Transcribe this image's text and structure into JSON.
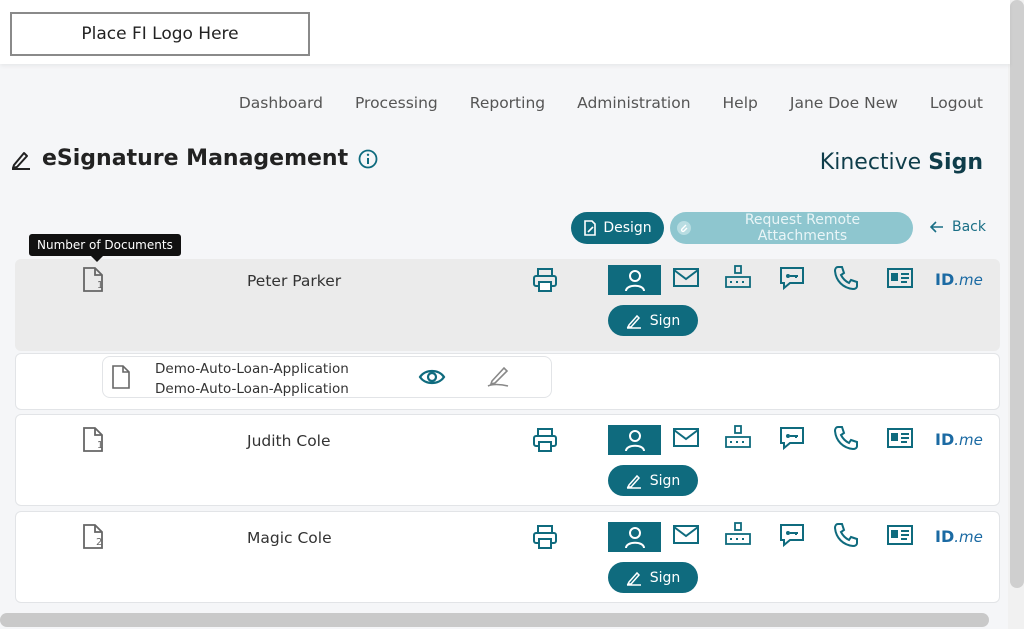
{
  "header": {
    "logo_placeholder": "Place FI Logo Here"
  },
  "nav": {
    "items": [
      "Dashboard",
      "Processing",
      "Reporting",
      "Administration",
      "Help",
      "Jane Doe New",
      "Logout"
    ]
  },
  "page": {
    "title": "eSignature Management",
    "brand_light": "Kinective ",
    "brand_bold": "Sign"
  },
  "toolbar": {
    "design_label": "Design",
    "remote_attachments_label": "Request Remote Attachments",
    "back_label": "Back"
  },
  "tooltip": {
    "text": "Number of Documents"
  },
  "signers": [
    {
      "name": "Peter Parker",
      "doc_count": "1",
      "sign_label": "Sign",
      "idme_prefix": "ID",
      "idme_suffix": ".me"
    },
    {
      "name": "Judith Cole",
      "doc_count": "1",
      "sign_label": "Sign",
      "idme_prefix": "ID",
      "idme_suffix": ".me"
    },
    {
      "name": "Magic Cole",
      "doc_count": "2",
      "sign_label": "Sign",
      "idme_prefix": "ID",
      "idme_suffix": ".me"
    }
  ],
  "documents": [
    {
      "line1": "Demo-Auto-Loan-Application",
      "line2": "Demo-Auto-Loan-Application"
    }
  ],
  "colors": {
    "primary": "#0f6b7e",
    "primary_disabled": "#8ec6cf",
    "brand_text": "#0f3d4a",
    "idme_blue": "#1b6aa3"
  }
}
